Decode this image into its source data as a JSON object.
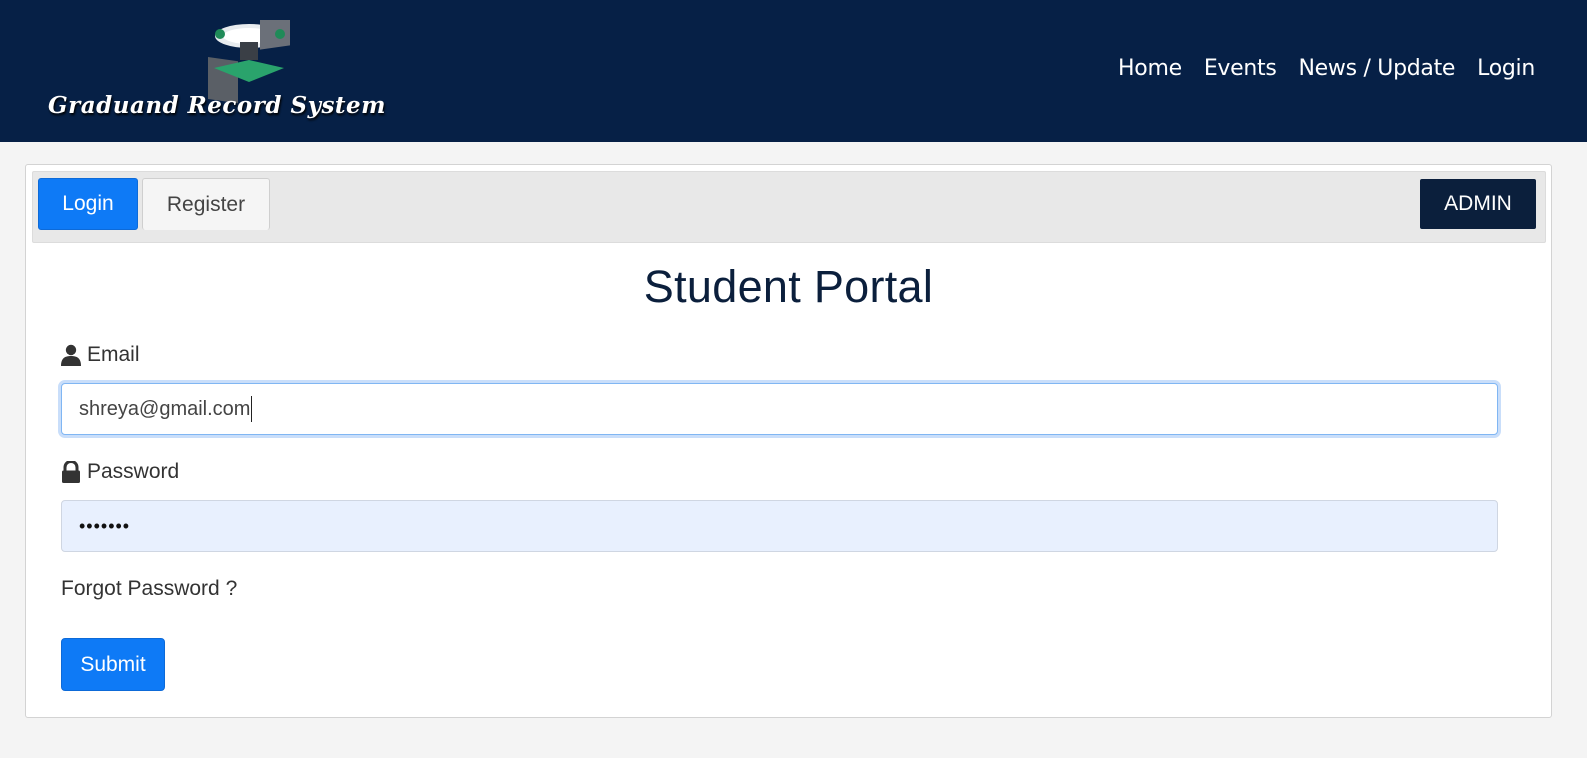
{
  "header": {
    "logo_text": "Graduand Record System",
    "nav": [
      "Home",
      "Events",
      "News / Update",
      "Login"
    ]
  },
  "tabs": {
    "login": "Login",
    "register": "Register",
    "admin": "ADMIN"
  },
  "form": {
    "title": "Student Portal",
    "email_label": "Email",
    "email_value": "shreya@gmail.com",
    "password_label": "Password",
    "password_value": "•••••••",
    "forgot": "Forgot Password ?",
    "submit": "Submit"
  },
  "colors": {
    "header_bg": "#062046",
    "accent": "#0e7af6",
    "admin_bg": "#0b1f3c"
  },
  "icons": {
    "email": "user-icon",
    "password": "lock-icon",
    "logo": "graduation-cap-logo-icon"
  }
}
